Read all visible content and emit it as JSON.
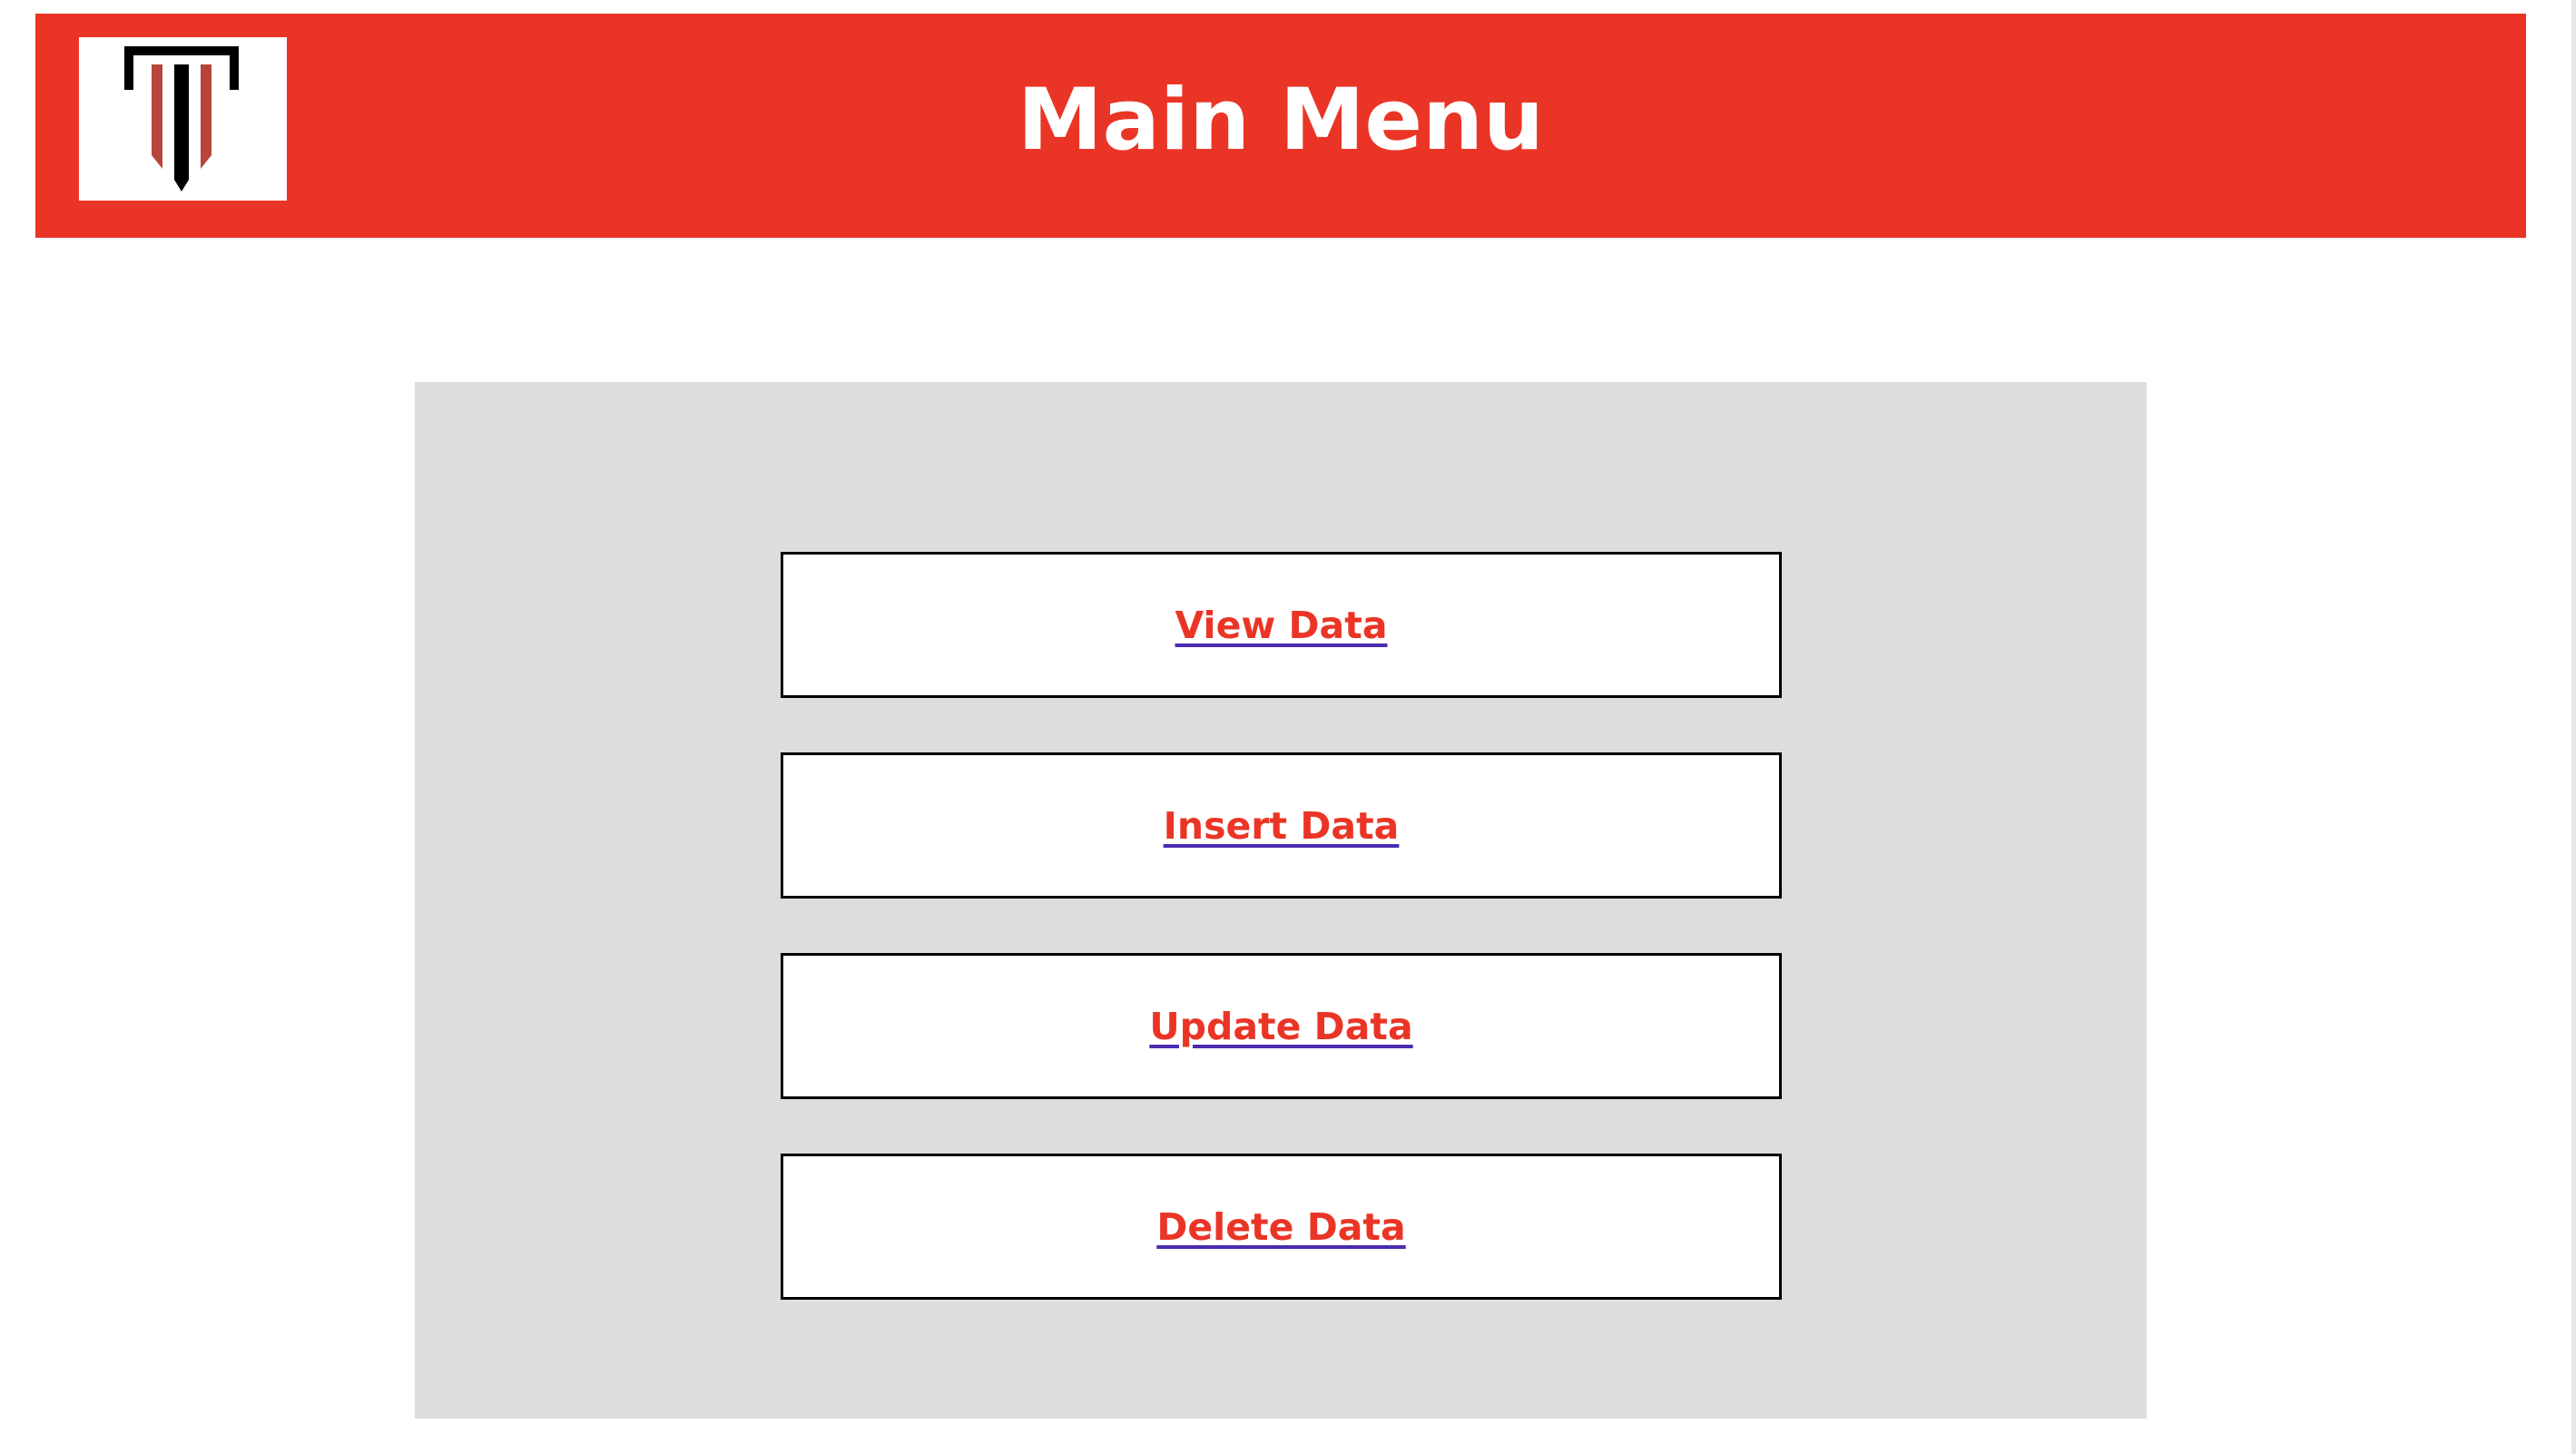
{
  "header": {
    "title": "Main Menu",
    "logo_icon": "column-pillar-logo-icon",
    "background_color": "#ea3526"
  },
  "menu": {
    "items": [
      {
        "label": "View Data"
      },
      {
        "label": "Insert Data"
      },
      {
        "label": "Update Data"
      },
      {
        "label": "Delete Data"
      }
    ],
    "panel_color": "#dddddd",
    "link_color": "#ea3526"
  }
}
